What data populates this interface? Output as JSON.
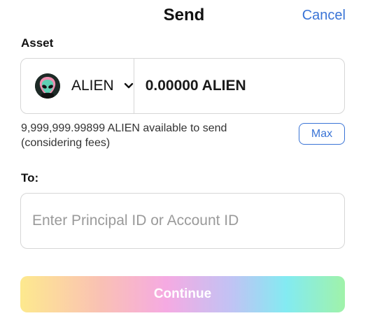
{
  "header": {
    "title": "Send",
    "cancel_label": "Cancel"
  },
  "asset": {
    "label": "Asset",
    "selected_token": "ALIEN",
    "token_icon": "alien-head-icon",
    "amount_value": "0.00000 ALIEN",
    "available_text": "9,999,999.99899 ALIEN available to send (considering fees)",
    "max_label": "Max"
  },
  "recipient": {
    "label": "To:",
    "placeholder": "Enter Principal ID or Account ID",
    "value": ""
  },
  "continue_label": "Continue",
  "colors": {
    "accent": "#3a74d6",
    "border": "#d6d6d6",
    "gradient": [
      "#fde57a",
      "#f9b6a8",
      "#f49cde",
      "#b7b9f3",
      "#6de7ef",
      "#8ff09a"
    ]
  }
}
